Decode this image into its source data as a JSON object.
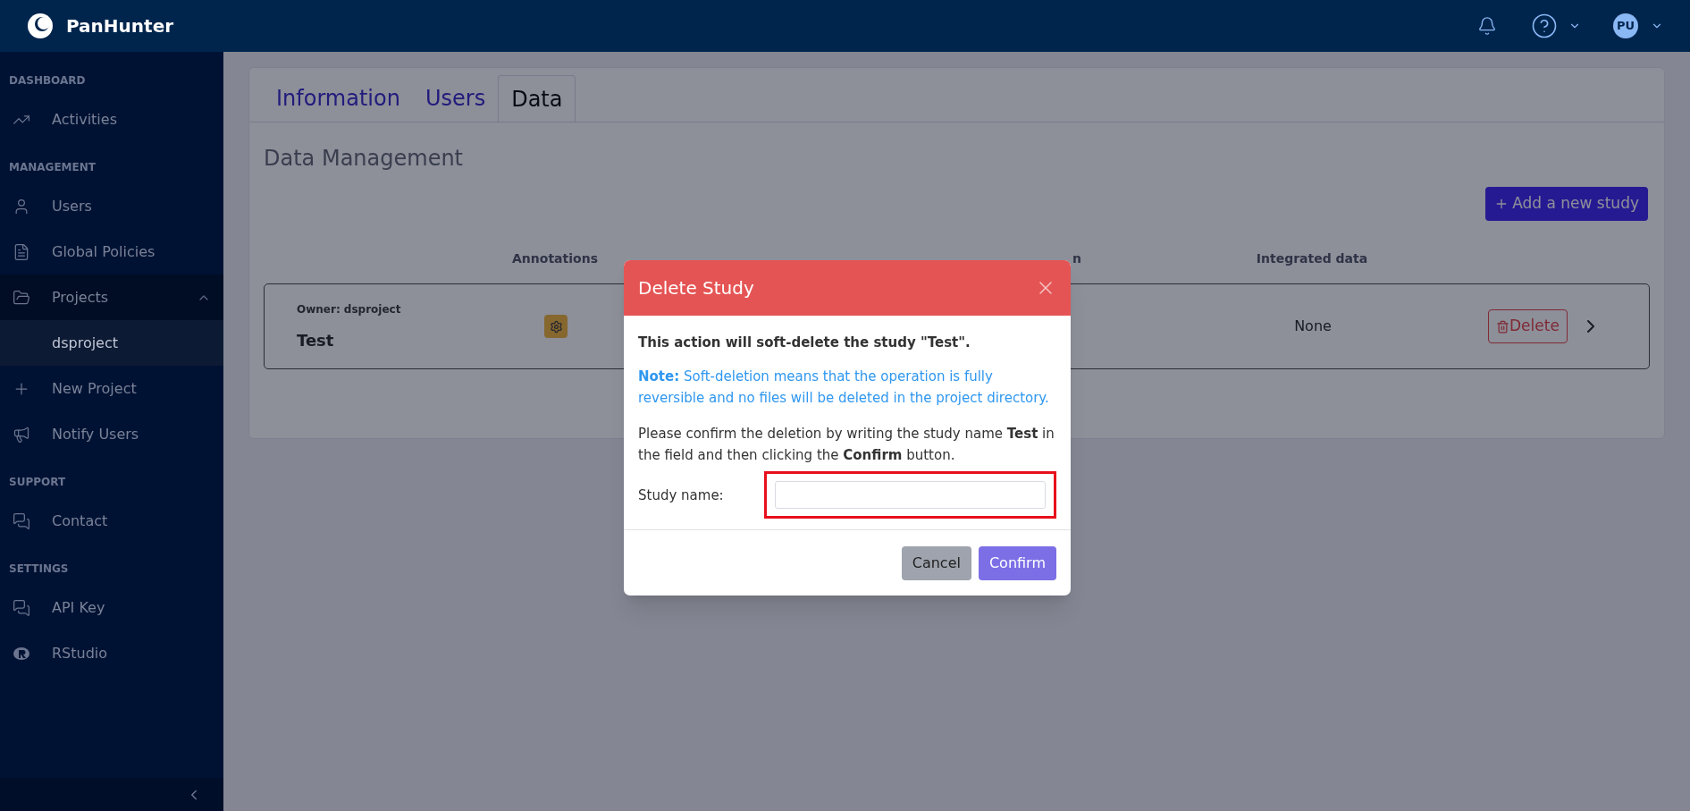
{
  "app": {
    "name": "PanHunter"
  },
  "topbar": {
    "avatar": "PU"
  },
  "sidebar": {
    "sections": [
      {
        "title": "DASHBOARD",
        "items": [
          {
            "label": "Activities",
            "selected": false
          }
        ]
      },
      {
        "title": "MANAGEMENT",
        "items": [
          {
            "label": "Users",
            "selected": false
          },
          {
            "label": "Global Policies",
            "selected": false
          },
          {
            "label": "Projects",
            "selected": false,
            "expanded": true,
            "children": [
              {
                "label": "dsproject",
                "selected": true
              }
            ]
          },
          {
            "label": "New Project",
            "selected": false
          },
          {
            "label": "Notify Users",
            "selected": false
          }
        ]
      },
      {
        "title": "SUPPORT",
        "items": [
          {
            "label": "Contact",
            "selected": false
          }
        ]
      },
      {
        "title": "SETTINGS",
        "items": [
          {
            "label": "API Key",
            "selected": false
          },
          {
            "label": "RStudio",
            "selected": false
          }
        ]
      }
    ]
  },
  "tabs": [
    {
      "label": "Information",
      "selected": false
    },
    {
      "label": "Users",
      "selected": false
    },
    {
      "label": "Data",
      "selected": true
    }
  ],
  "page": {
    "title": "Data Management",
    "add_button": "Add a new study"
  },
  "table": {
    "columns": [
      "Annotations",
      "n",
      "Integrated data"
    ],
    "rows": [
      {
        "owner": "Owner: dsproject",
        "name": "Test",
        "integrated": "None",
        "delete": "Delete"
      }
    ]
  },
  "modal": {
    "title": "Delete Study",
    "warning": "This action will soft-delete the study \"Test\".",
    "note": "**Note:** Soft-deletion means that the operation is fully reversible and no files will be deleted in the project directory.",
    "instruction": "Please confirm the deletion by writing the study name **Test** in the field and then clicking the **Confirm** button.",
    "field_label": "Study name:",
    "buttons": [
      "Cancel",
      "Confirm"
    ]
  }
}
